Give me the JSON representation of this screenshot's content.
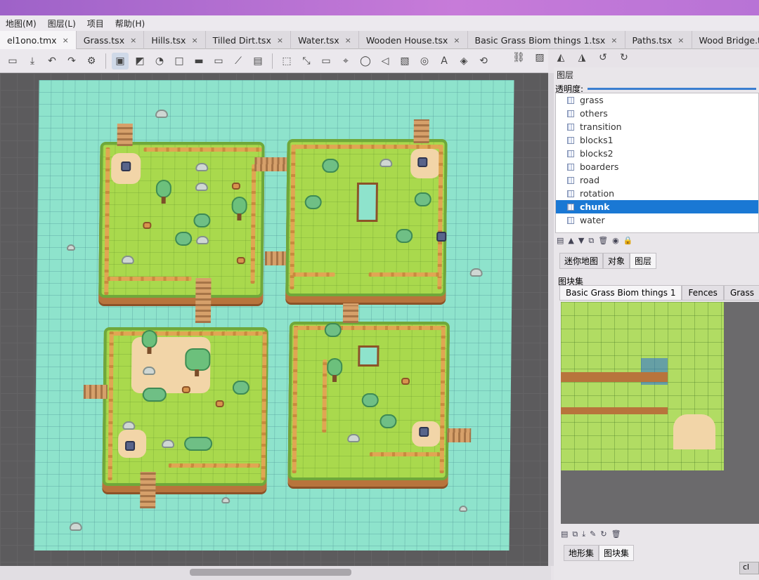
{
  "menu": [
    "地图(M)",
    "图层(L)",
    "项目",
    "帮助(H)"
  ],
  "tabs": [
    {
      "label": "el1ono.tmx",
      "active": true
    },
    {
      "label": "Grass.tsx",
      "active": false
    },
    {
      "label": "Hills.tsx",
      "active": false
    },
    {
      "label": "Tilled Dirt.tsx",
      "active": false
    },
    {
      "label": "Water.tsx",
      "active": false
    },
    {
      "label": "Wooden House.tsx",
      "active": false
    },
    {
      "label": "Basic Grass Biom things 1.tsx",
      "active": false
    },
    {
      "label": "Paths.tsx",
      "active": false
    },
    {
      "label": "Wood Bridge.tsx",
      "active": false
    }
  ],
  "tab_close": "×",
  "layers_panel": {
    "title": "图层",
    "opacity_label": "透明度:",
    "layers": [
      "grass",
      "others",
      "transition",
      "blocks1",
      "blocks2",
      "boarders",
      "road",
      "rotation",
      "chunk",
      "water"
    ],
    "selected": "chunk"
  },
  "mid_tabs": [
    {
      "label": "迷你地图",
      "active": false
    },
    {
      "label": "对象",
      "active": false
    },
    {
      "label": "图层",
      "active": true
    }
  ],
  "tileset_panel": {
    "title": "图块集",
    "tabs": [
      {
        "label": "Basic Grass Biom things 1",
        "active": true
      },
      {
        "label": "Fences",
        "active": false
      },
      {
        "label": "Grass",
        "active": false
      }
    ]
  },
  "bottom_tabs": [
    {
      "label": "地形集",
      "active": false
    },
    {
      "label": "图块集",
      "active": true
    }
  ],
  "status_chip": "cl",
  "icons": [
    "new-icon",
    "open-icon",
    "save-icon",
    "undo-icon",
    "redo-icon",
    "stamp-icon",
    "bucket-icon",
    "eraser-icon",
    "select-icon",
    "magic-wand-icon",
    "rect-icon",
    "ellipse-icon",
    "polygon-icon",
    "text-icon",
    "zoom-icon"
  ]
}
